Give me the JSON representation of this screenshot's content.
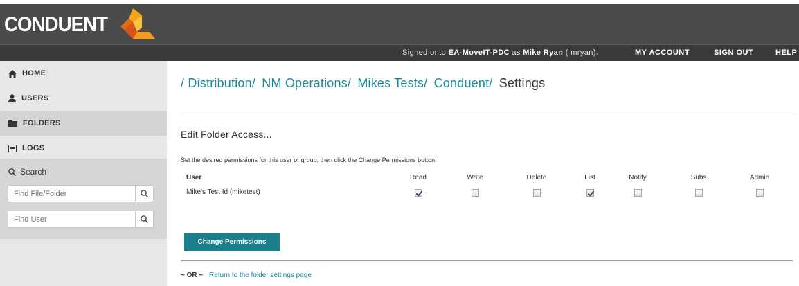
{
  "header": {
    "logo_text": "CONDUENT",
    "signed_prefix": "Signed onto ",
    "server": "EA-MoveIT-PDC",
    "as_text": " as ",
    "user_name": "Mike Ryan",
    "user_login": " ( mryan).",
    "nav": [
      "MY ACCOUNT",
      "SIGN OUT",
      "HELP"
    ]
  },
  "sidebar": {
    "items": [
      {
        "label": "HOME",
        "icon": "home-icon"
      },
      {
        "label": "USERS",
        "icon": "user-icon"
      },
      {
        "label": "FOLDERS",
        "icon": "folder-icon"
      },
      {
        "label": "LOGS",
        "icon": "logs-icon"
      }
    ],
    "search": {
      "title": "Search",
      "file_placeholder": "Find File/Folder",
      "user_placeholder": "Find User"
    }
  },
  "main": {
    "breadcrumb": [
      "/ Distribution/",
      "NM Operations/",
      "Mikes Tests/",
      "Conduent/"
    ],
    "current": "Settings",
    "section_title": "Edit Folder Access...",
    "instructions": "Set the desired permissions for this user or group, then click the Change Permissions button.",
    "table": {
      "user_header": "User",
      "columns": [
        "Read",
        "Write",
        "Delete",
        "List",
        "Notify",
        "Subs",
        "Admin"
      ],
      "rows": [
        {
          "user": "Mike's Test Id (miketest)",
          "checked": [
            true,
            false,
            false,
            true,
            false,
            false,
            false
          ]
        }
      ]
    },
    "change_button": "Change Permissions",
    "or_text": "~ OR ~",
    "return_link": "Return to the folder settings page"
  },
  "colors": {
    "banner": "#4a4a4a",
    "infobar": "#3a3a3a",
    "accent": "#1b7f8e",
    "sidebar": "#e7e7e7"
  }
}
